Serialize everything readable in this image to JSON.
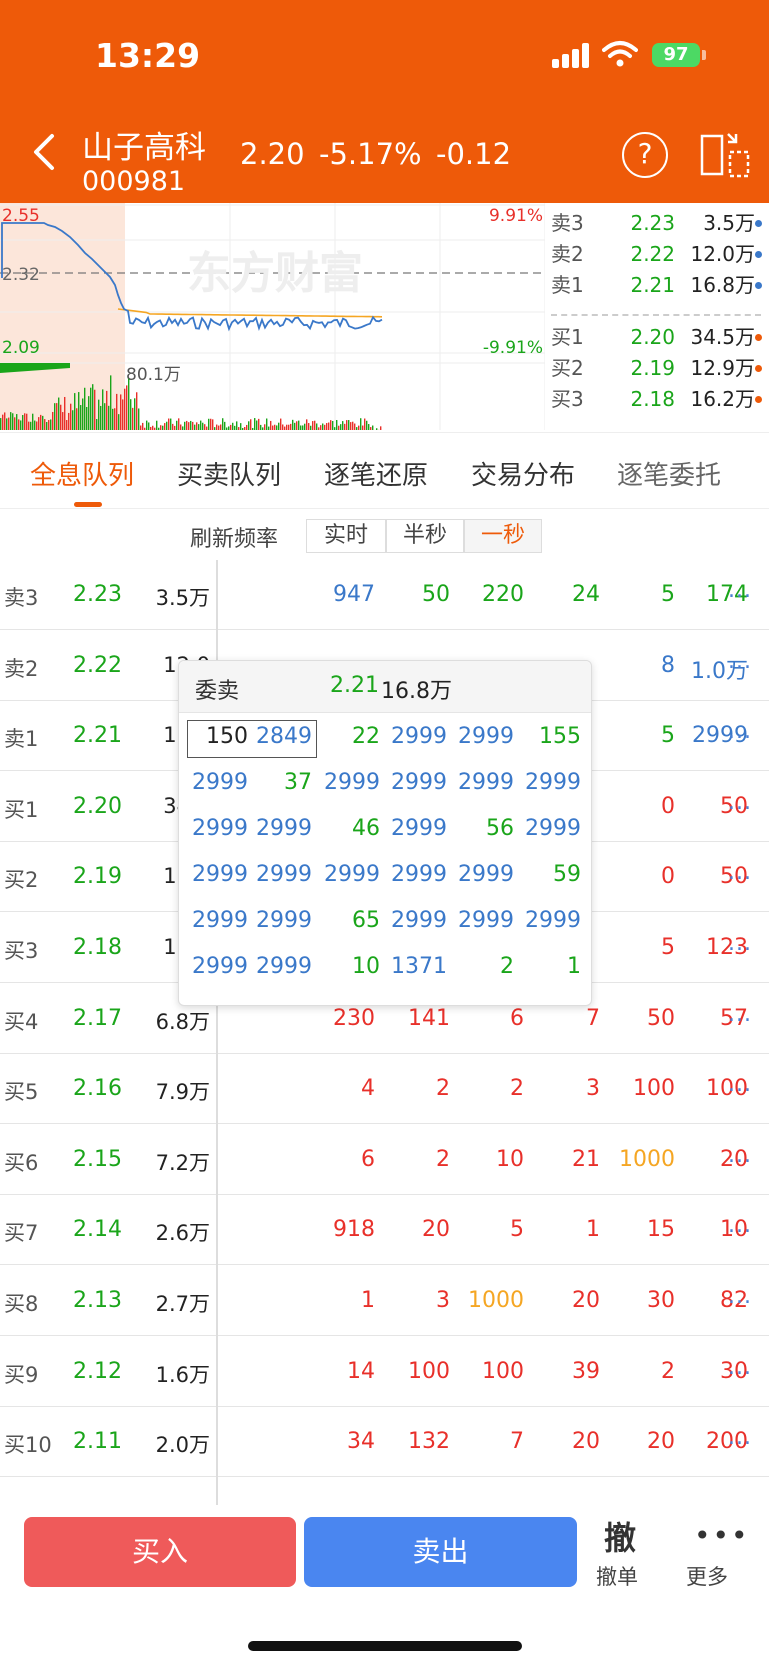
{
  "status": {
    "time": "13:29",
    "battery": "97"
  },
  "stock": {
    "name": "山子高科",
    "code": "000981",
    "price": "2.20",
    "change_pct": "-5.17%",
    "change": "-0.12"
  },
  "header": {
    "help_symbol": "?"
  },
  "chart": {
    "high_label": "2.55",
    "mid_label": "2.32",
    "low_label": "2.09",
    "up_pct": "9.91%",
    "down_pct": "-9.91%",
    "volume_label": "80.1万",
    "watermark": "东方财富",
    "colors": {
      "price_line": "#3A78C9",
      "avg_line": "#F5A623",
      "up": "#E8302A",
      "down": "#1AA51A"
    }
  },
  "order_book": [
    {
      "label": "卖3",
      "price": "2.23",
      "volume": "3.5万",
      "dot": "#3A78C9"
    },
    {
      "label": "卖2",
      "price": "2.22",
      "volume": "12.0万",
      "dot": "#3A78C9"
    },
    {
      "label": "卖1",
      "price": "2.21",
      "volume": "16.8万",
      "dot": "#3A78C9"
    },
    {
      "label": "买1",
      "price": "2.20",
      "volume": "34.5万",
      "dot": "#EE5A09"
    },
    {
      "label": "买2",
      "price": "2.19",
      "volume": "12.9万",
      "dot": "#EE5A09"
    },
    {
      "label": "买3",
      "price": "2.18",
      "volume": "16.2万",
      "dot": "#EE5A09"
    }
  ],
  "tabs": [
    "全息队列",
    "买卖队列",
    "逐笔还原",
    "交易分布",
    "逐笔委托"
  ],
  "refresh": {
    "label": "刷新频率",
    "options": [
      "实时",
      "半秒",
      "一秒"
    ],
    "selected": "一秒"
  },
  "queue": {
    "more": "...",
    "rows": [
      {
        "label": "卖3",
        "price": "2.23",
        "volume": "3.5万",
        "cells": [
          {
            "v": "947",
            "c": "blue"
          },
          {
            "v": "50",
            "c": "green"
          },
          {
            "v": "220",
            "c": "green"
          },
          {
            "v": "24",
            "c": "green"
          },
          {
            "v": "5",
            "c": "green"
          },
          {
            "v": "174",
            "c": "green"
          }
        ]
      },
      {
        "label": "卖2",
        "price": "2.22",
        "volume": "12.0",
        "cells": [
          {
            "v": "",
            "c": ""
          },
          {
            "v": "",
            "c": ""
          },
          {
            "v": "",
            "c": ""
          },
          {
            "v": "",
            "c": ""
          },
          {
            "v": "8",
            "c": "blue"
          },
          {
            "v": "1.0万",
            "c": "blue"
          }
        ]
      },
      {
        "label": "卖1",
        "price": "2.21",
        "volume": "16.8",
        "cells": [
          {
            "v": "",
            "c": ""
          },
          {
            "v": "",
            "c": ""
          },
          {
            "v": "",
            "c": ""
          },
          {
            "v": "",
            "c": ""
          },
          {
            "v": "5",
            "c": "green"
          },
          {
            "v": "2999",
            "c": "blue"
          }
        ]
      },
      {
        "label": "买1",
        "price": "2.20",
        "volume": "34.5",
        "cells": [
          {
            "v": "",
            "c": ""
          },
          {
            "v": "",
            "c": ""
          },
          {
            "v": "",
            "c": ""
          },
          {
            "v": "",
            "c": ""
          },
          {
            "v": "0",
            "c": "red"
          },
          {
            "v": "50",
            "c": "red"
          }
        ]
      },
      {
        "label": "买2",
        "price": "2.19",
        "volume": "12.9",
        "cells": [
          {
            "v": "",
            "c": ""
          },
          {
            "v": "",
            "c": ""
          },
          {
            "v": "",
            "c": ""
          },
          {
            "v": "",
            "c": ""
          },
          {
            "v": "0",
            "c": "red"
          },
          {
            "v": "50",
            "c": "red"
          }
        ]
      },
      {
        "label": "买3",
        "price": "2.18",
        "volume": "16.2",
        "cells": [
          {
            "v": "",
            "c": ""
          },
          {
            "v": "",
            "c": ""
          },
          {
            "v": "",
            "c": ""
          },
          {
            "v": "",
            "c": ""
          },
          {
            "v": "5",
            "c": "red"
          },
          {
            "v": "123",
            "c": "red"
          }
        ]
      },
      {
        "label": "买4",
        "price": "2.17",
        "volume": "6.8万",
        "cells": [
          {
            "v": "230",
            "c": "red"
          },
          {
            "v": "141",
            "c": "red"
          },
          {
            "v": "6",
            "c": "red"
          },
          {
            "v": "7",
            "c": "red"
          },
          {
            "v": "50",
            "c": "red"
          },
          {
            "v": "57",
            "c": "red"
          }
        ]
      },
      {
        "label": "买5",
        "price": "2.16",
        "volume": "7.9万",
        "cells": [
          {
            "v": "4",
            "c": "red"
          },
          {
            "v": "2",
            "c": "red"
          },
          {
            "v": "2",
            "c": "red"
          },
          {
            "v": "3",
            "c": "red"
          },
          {
            "v": "100",
            "c": "red"
          },
          {
            "v": "100",
            "c": "red"
          }
        ]
      },
      {
        "label": "买6",
        "price": "2.15",
        "volume": "7.2万",
        "cells": [
          {
            "v": "6",
            "c": "red"
          },
          {
            "v": "2",
            "c": "red"
          },
          {
            "v": "10",
            "c": "red"
          },
          {
            "v": "21",
            "c": "red"
          },
          {
            "v": "1000",
            "c": "orange"
          },
          {
            "v": "20",
            "c": "red"
          }
        ]
      },
      {
        "label": "买7",
        "price": "2.14",
        "volume": "2.6万",
        "cells": [
          {
            "v": "918",
            "c": "red"
          },
          {
            "v": "20",
            "c": "red"
          },
          {
            "v": "5",
            "c": "red"
          },
          {
            "v": "1",
            "c": "red"
          },
          {
            "v": "15",
            "c": "red"
          },
          {
            "v": "10",
            "c": "red"
          }
        ]
      },
      {
        "label": "买8",
        "price": "2.13",
        "volume": "2.7万",
        "cells": [
          {
            "v": "1",
            "c": "red"
          },
          {
            "v": "3",
            "c": "red"
          },
          {
            "v": "1000",
            "c": "orange"
          },
          {
            "v": "20",
            "c": "red"
          },
          {
            "v": "30",
            "c": "red"
          },
          {
            "v": "82",
            "c": "red"
          }
        ]
      },
      {
        "label": "买9",
        "price": "2.12",
        "volume": "1.6万",
        "cells": [
          {
            "v": "14",
            "c": "red"
          },
          {
            "v": "100",
            "c": "red"
          },
          {
            "v": "100",
            "c": "red"
          },
          {
            "v": "39",
            "c": "red"
          },
          {
            "v": "2",
            "c": "red"
          },
          {
            "v": "30",
            "c": "red"
          }
        ]
      },
      {
        "label": "买10",
        "price": "2.11",
        "volume": "2.0万",
        "cells": [
          {
            "v": "34",
            "c": "red"
          },
          {
            "v": "132",
            "c": "red"
          },
          {
            "v": "7",
            "c": "red"
          },
          {
            "v": "20",
            "c": "red"
          },
          {
            "v": "20",
            "c": "red"
          },
          {
            "v": "200",
            "c": "red"
          }
        ]
      }
    ]
  },
  "popup": {
    "title": "委卖",
    "price": "2.21",
    "volume": "16.8万",
    "rows": [
      [
        {
          "v": "150",
          "c": ""
        },
        {
          "v": "2849",
          "c": "blue"
        },
        {
          "v": "22",
          "c": "green"
        },
        {
          "v": "2999",
          "c": "blue"
        },
        {
          "v": "2999",
          "c": "blue"
        },
        {
          "v": "155",
          "c": "green"
        }
      ],
      [
        {
          "v": "2999",
          "c": "blue"
        },
        {
          "v": "37",
          "c": "green"
        },
        {
          "v": "2999",
          "c": "blue"
        },
        {
          "v": "2999",
          "c": "blue"
        },
        {
          "v": "2999",
          "c": "blue"
        },
        {
          "v": "2999",
          "c": "blue"
        }
      ],
      [
        {
          "v": "2999",
          "c": "blue"
        },
        {
          "v": "2999",
          "c": "blue"
        },
        {
          "v": "46",
          "c": "green"
        },
        {
          "v": "2999",
          "c": "blue"
        },
        {
          "v": "56",
          "c": "green"
        },
        {
          "v": "2999",
          "c": "blue"
        }
      ],
      [
        {
          "v": "2999",
          "c": "blue"
        },
        {
          "v": "2999",
          "c": "blue"
        },
        {
          "v": "2999",
          "c": "blue"
        },
        {
          "v": "2999",
          "c": "blue"
        },
        {
          "v": "2999",
          "c": "blue"
        },
        {
          "v": "59",
          "c": "green"
        }
      ],
      [
        {
          "v": "2999",
          "c": "blue"
        },
        {
          "v": "2999",
          "c": "blue"
        },
        {
          "v": "65",
          "c": "green"
        },
        {
          "v": "2999",
          "c": "blue"
        },
        {
          "v": "2999",
          "c": "blue"
        },
        {
          "v": "2999",
          "c": "blue"
        }
      ],
      [
        {
          "v": "2999",
          "c": "blue"
        },
        {
          "v": "2999",
          "c": "blue"
        },
        {
          "v": "10",
          "c": "green"
        },
        {
          "v": "1371",
          "c": "blue"
        },
        {
          "v": "2",
          "c": "green"
        },
        {
          "v": "1",
          "c": "green"
        }
      ]
    ]
  },
  "bottom": {
    "buy": "买入",
    "sell": "卖出",
    "cancel_icon": "撤",
    "cancel": "撤单",
    "more_icon": "•••",
    "more": "更多"
  },
  "colors": {
    "brand": "#EE5A09",
    "buy": "#EF5A5A",
    "sell": "#4A86F0"
  }
}
